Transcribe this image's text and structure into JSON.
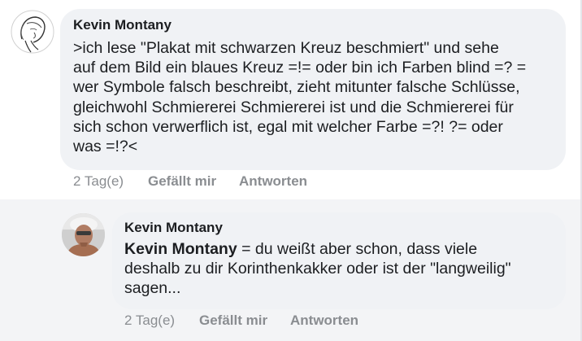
{
  "comment": {
    "author": "Kevin Montany",
    "text": ">ich lese \"Plakat mit schwarzen Kreuz beschmiert\"  und sehe\nauf dem Bild ein blaues Kreuz =!= oder bin ich Farben blind =? =\nwer Symbole falsch beschreibt, zieht mitunter falsche Schlüsse,\ngleichwohl Schmiererei Schmiererei ist und die Schmiererei für\nsich schon verwerflich ist, egal mit welcher Farbe =?! ?= oder\nwas =!?<",
    "timestamp": "2 Tag(e)",
    "like_label": "Gefällt mir",
    "reply_label": "Antworten"
  },
  "reply": {
    "author": "Kevin Montany",
    "mention": "Kevin Montany",
    "text": " =  du weißt aber schon, dass viele\ndeshalb zu dir Korinthenkakker oder ist der  \"langweilig\"\nsagen...",
    "timestamp": "2 Tag(e)",
    "like_label": "Gefällt mir",
    "reply_label": "Antworten"
  },
  "colors": {
    "bubble": "#f0f2f5",
    "reply_background": "#f3f4f6",
    "text": "#1c1e21",
    "meta": "#8a8d91"
  },
  "icons": {
    "comment_avatar": "sketch-portrait-avatar",
    "reply_avatar": "photo-portrait-avatar"
  }
}
